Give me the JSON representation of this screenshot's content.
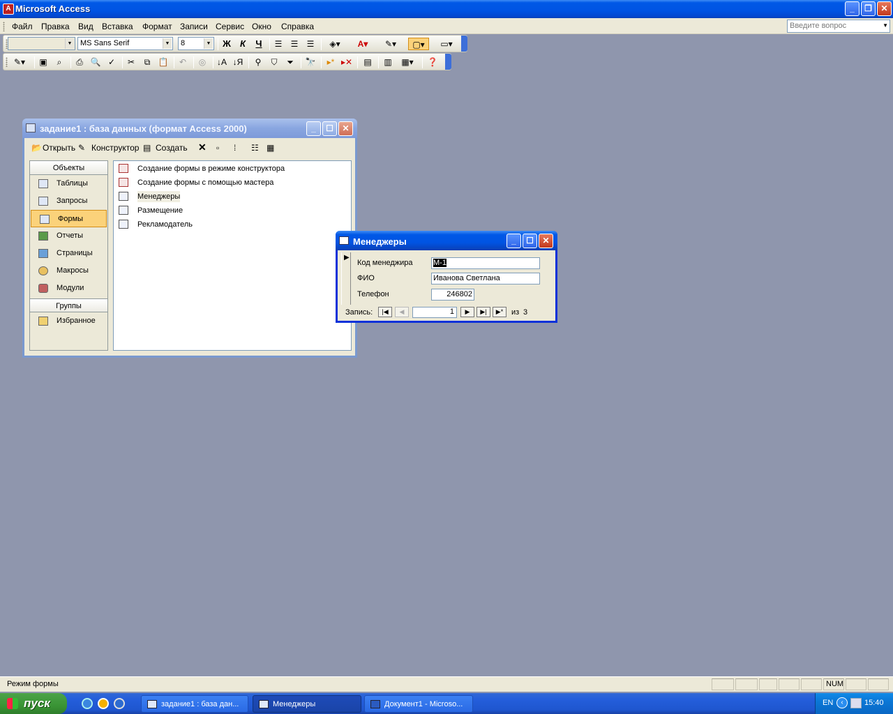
{
  "app": {
    "title": "Microsoft Access"
  },
  "menu": [
    "Файл",
    "Правка",
    "Вид",
    "Вставка",
    "Формат",
    "Записи",
    "Сервис",
    "Окно",
    "Справка"
  ],
  "ask_placeholder": "Введите вопрос",
  "format_toolbar": {
    "object_combo": "",
    "font": "MS Sans Serif",
    "size": "8",
    "bold": "Ж",
    "italic": "К",
    "underline": "Ч"
  },
  "db_window": {
    "title": "задание1 : база данных (формат Access 2000)",
    "tools": {
      "open": "Открыть",
      "design": "Конструктор",
      "create": "Создать"
    },
    "objects_header": "Объекты",
    "objects": [
      "Таблицы",
      "Запросы",
      "Формы",
      "Отчеты",
      "Страницы",
      "Макросы",
      "Модули"
    ],
    "selected_object": "Формы",
    "groups_header": "Группы",
    "groups": [
      "Избранное"
    ],
    "list": [
      "Создание формы в режиме конструктора",
      "Создание формы с помощью мастера",
      "Менеджеры",
      "Размещение",
      "Рекламодатель"
    ]
  },
  "form": {
    "title": "Менеджеры",
    "fields": [
      {
        "label": "Код менеджира",
        "value": "М-1"
      },
      {
        "label": "ФИО",
        "value": "Иванова Светлана"
      },
      {
        "label": "Телефон",
        "value": "246802"
      }
    ],
    "nav": {
      "label": "Запись:",
      "current": "1",
      "of_label": "из",
      "total": "3"
    }
  },
  "status": {
    "text": "Режим формы",
    "num": "NUM"
  },
  "taskbar": {
    "start": "пуск",
    "tasks": [
      "задание1 : база дан...",
      "Менеджеры",
      "Документ1 - Microso..."
    ],
    "lang": "EN",
    "time": "15:40"
  }
}
